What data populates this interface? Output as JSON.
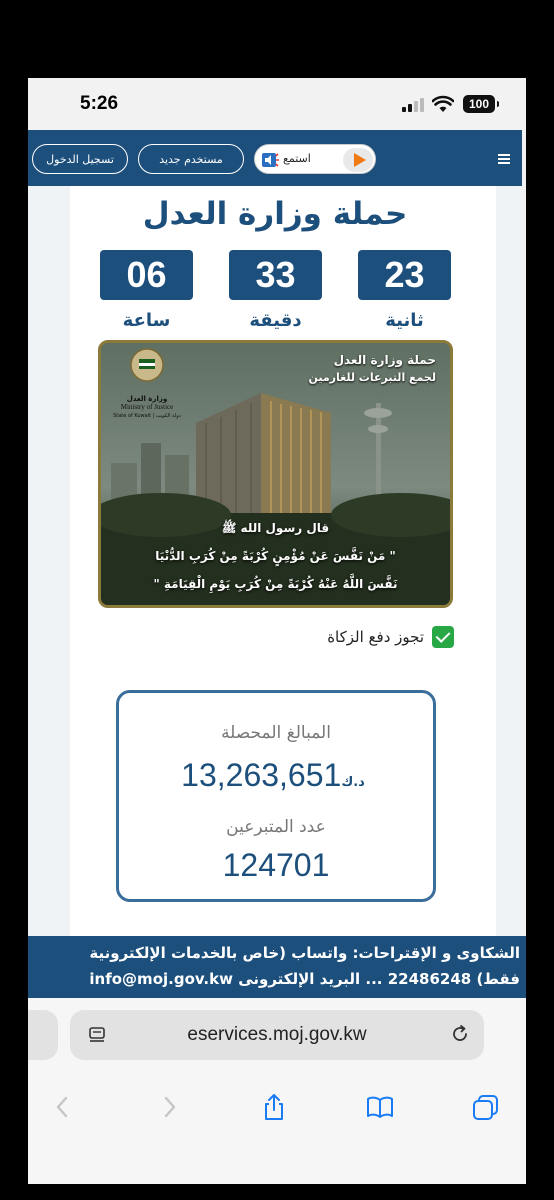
{
  "status_bar": {
    "time": "5:26",
    "battery": "100"
  },
  "navbar": {
    "login_label": "تسجيل الدخول",
    "new_user_label": "مستخدم جديد",
    "listen_label": "استمع",
    "menu_icon": "hamburger-icon"
  },
  "campaign": {
    "title": "حملة وزارة العدل",
    "countdown": [
      {
        "value": "06",
        "label": "ساعة"
      },
      {
        "value": "33",
        "label": "دقيقة"
      },
      {
        "value": "23",
        "label": "ثانية"
      }
    ]
  },
  "banner": {
    "heading_line1": "حملة وزارة العدل",
    "heading_line2": "لجمع التبرعات للغارمين",
    "logo_arabic": "وزارة العدل",
    "logo_english": "Ministry of Justice",
    "logo_state": "State of Kuwait | دولة الكويت",
    "hadith_line1": "قال رسول الله ﷺ",
    "hadith_line2": "\" مَنْ نَفَّسَ عَنْ مُؤْمِنٍ كُرْبَةً مِنْ كُرَبِ الدُّنْيَا",
    "hadith_line3": "نَفَّسَ اللَّهُ عَنْهُ كُرْبَةً مِنْ كُرَبِ يَوْمِ الْقِيَامَةِ \""
  },
  "zakat": {
    "label": "تجوز دفع الزكاة",
    "checked": true
  },
  "stats": {
    "collected_label": "المبالغ المحصلة",
    "collected_amount": "13,263,651",
    "currency": "د.ك",
    "donors_label": "عدد المتبرعين",
    "donors_count": "124701"
  },
  "footer": {
    "line1": "الشكاوى و الإقتراحات: واتساب (خاص بالخدمات الإلكترونية",
    "line2": "فقط) 22486248 ... البريد الإلكترونى info@moj.gov.kw"
  },
  "browser": {
    "url": "eservices.moj.gov.kw"
  },
  "colors": {
    "primary": "#1d4f7c",
    "accent_orange": "#ef7a12",
    "check_green": "#28a745",
    "banner_gold": "#8c7a3a"
  }
}
